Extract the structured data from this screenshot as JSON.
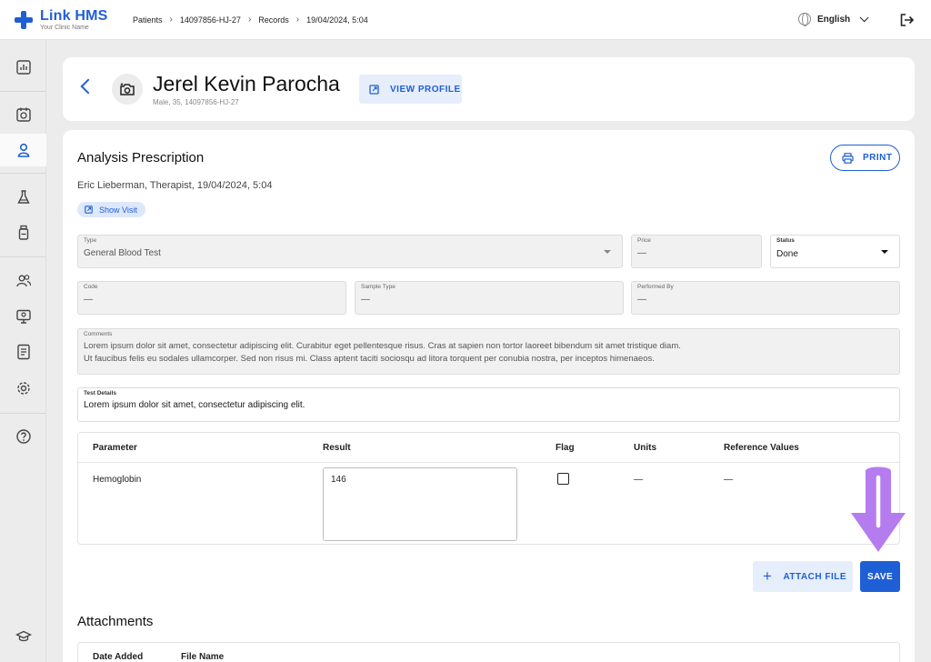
{
  "brand": {
    "name": "Link HMS",
    "subtitle": "Your Clinic Name",
    "color": "#1f5fd6"
  },
  "breadcrumb": [
    "Patients",
    "14097856-HJ-27",
    "Records",
    "19/04/2024, 5:04"
  ],
  "header": {
    "language": "English"
  },
  "patient": {
    "name": "Jerel Kevin Parocha",
    "meta": "Male, 35, 14097856-HJ-27",
    "view_profile_label": "VIEW PROFILE"
  },
  "prescription": {
    "title": "Analysis Prescription",
    "print_label": "PRINT",
    "doctor_line": "Eric Lieberman, Therapist, 19/04/2024, 5:04",
    "show_visit_label": "Show Visit",
    "fields": {
      "type": {
        "label": "Type",
        "value": "General Blood Test"
      },
      "price": {
        "label": "Price",
        "value": "—"
      },
      "status": {
        "label": "Status",
        "value": "Done"
      },
      "code": {
        "label": "Code",
        "value": "—"
      },
      "sample_type": {
        "label": "Sample Type",
        "value": "—"
      },
      "performed_by": {
        "label": "Performed By",
        "value": "—"
      },
      "comments": {
        "label": "Comments",
        "line1": "Lorem ipsum dolor sit amet, consectetur adipiscing elit. Curabitur eget pellentesque risus. Cras at sapien non tortor laoreet bibendum sit amet tristique diam.",
        "line2": "Ut faucibus felis eu sodales ullamcorper. Sed non risus mi. Class aptent taciti sociosqu ad litora torquent per conubia nostra, per inceptos himenaeos."
      },
      "test_details": {
        "label": "Test Details",
        "value": "Lorem ipsum dolor sit amet, consectetur adipiscing elit."
      }
    },
    "table": {
      "headers": {
        "parameter": "Parameter",
        "result": "Result",
        "flag": "Flag",
        "units": "Units",
        "reference": "Reference Values"
      },
      "rows": [
        {
          "parameter": "Hemoglobin",
          "result": "146",
          "flagged": false,
          "units": "—",
          "reference": "—"
        }
      ]
    },
    "attach_label": "ATTACH FILE",
    "save_label": "SAVE"
  },
  "attachments": {
    "title": "Attachments",
    "headers": {
      "date_added": "Date Added",
      "file_name": "File Name"
    }
  },
  "sidebar": {
    "items": [
      {
        "icon": "dashboard-icon"
      },
      {
        "icon": "calendar-icon"
      },
      {
        "icon": "patient-icon",
        "active": true
      },
      {
        "icon": "lab-flask-icon"
      },
      {
        "icon": "medicine-bottle-icon"
      },
      {
        "icon": "staff-icon"
      },
      {
        "icon": "monitor-icon"
      },
      {
        "icon": "report-icon"
      },
      {
        "icon": "settings-icon"
      },
      {
        "icon": "help-icon"
      },
      {
        "icon": "education-icon"
      }
    ]
  },
  "annotation": {
    "color": "#b57cf0"
  }
}
